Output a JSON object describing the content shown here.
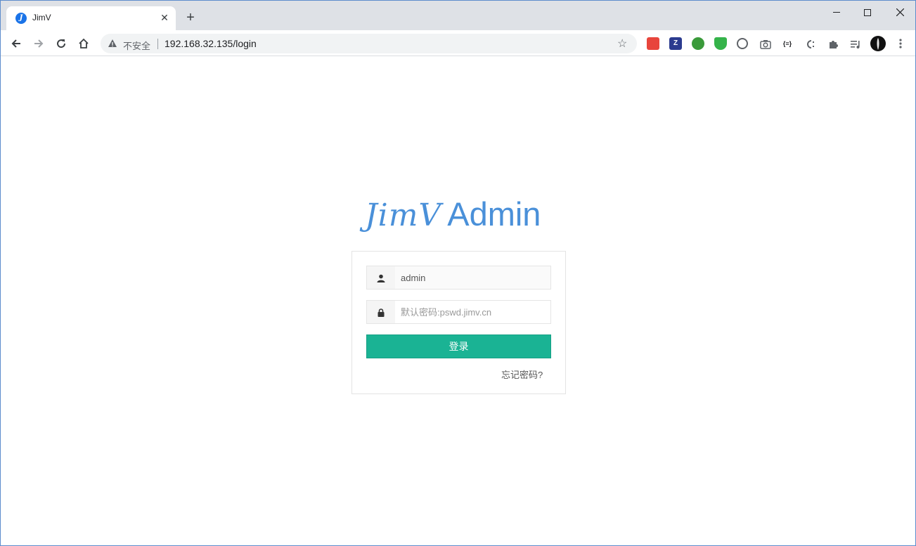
{
  "browser": {
    "tab_title": "JimV",
    "tab_favicon": "J",
    "tab_close": "✕",
    "new_tab": "+",
    "insecure_label": "不安全",
    "url": "192.168.32.135/login",
    "ext_labels": [
      "",
      "Z",
      "",
      "",
      "",
      "",
      "{≡}",
      "",
      "",
      ""
    ]
  },
  "page": {
    "brand_script": "JimV",
    "brand_admin": "Admin",
    "username_value": "admin",
    "password_placeholder": "默认密码:pswd.jimv.cn",
    "login_label": "登录",
    "forgot_label": "忘记密码?"
  },
  "colors": {
    "brand": "#4a90d9",
    "login_button": "#1ab394"
  }
}
